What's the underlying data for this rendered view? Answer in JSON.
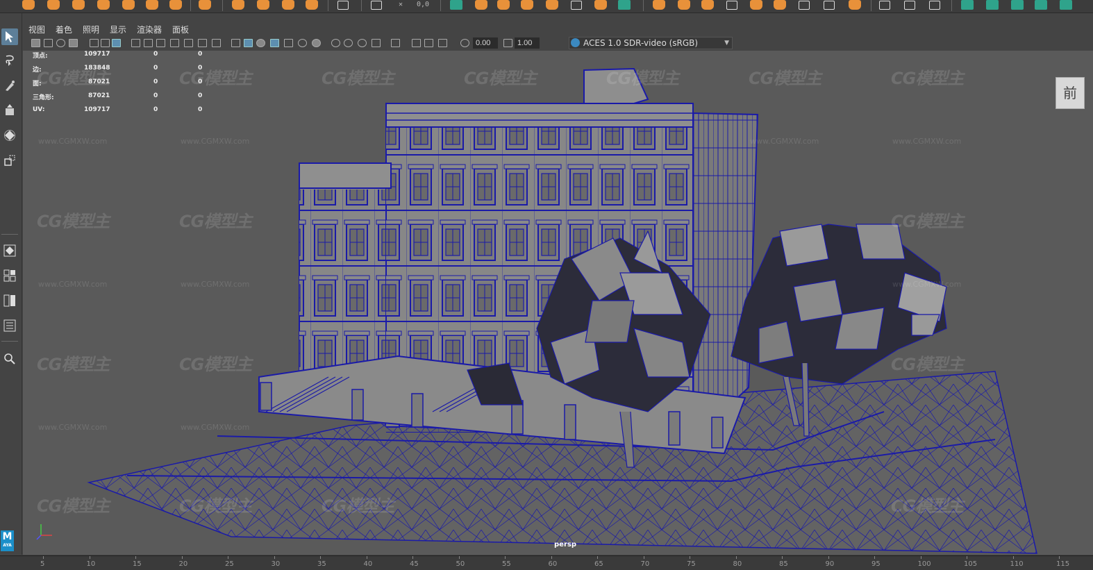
{
  "shelf": {
    "coord_readout": "0,0"
  },
  "panel_menu": {
    "items": [
      "视图",
      "着色",
      "照明",
      "显示",
      "渲染器",
      "面板"
    ]
  },
  "panel_toolbar": {
    "exposure": "0.00",
    "gamma": "1.00",
    "color_space": "ACES 1.0 SDR-video (sRGB)"
  },
  "hud": {
    "rows": [
      {
        "label": "顶点:",
        "value": "109717",
        "col2": "0",
        "col3": "0"
      },
      {
        "label": "边:",
        "value": "183848",
        "col2": "0",
        "col3": "0"
      },
      {
        "label": "面:",
        "value": "87021",
        "col2": "0",
        "col3": "0"
      },
      {
        "label": "三角形:",
        "value": "87021",
        "col2": "0",
        "col3": "0"
      },
      {
        "label": "UV:",
        "value": "109717",
        "col2": "0",
        "col3": "0"
      }
    ]
  },
  "view_cube": {
    "label": "前"
  },
  "camera_label": "persp",
  "watermark": {
    "logo_text": "CG模型主",
    "url_text": "www.CGMXW.com"
  },
  "timeline": {
    "ticks": [
      "5",
      "10",
      "15",
      "20",
      "25",
      "30",
      "35",
      "40",
      "45",
      "50",
      "55",
      "60",
      "65",
      "70",
      "75",
      "80",
      "85",
      "90",
      "95",
      "100",
      "105",
      "110",
      "115"
    ]
  },
  "maya_logo": {
    "big": "M",
    "small": "AYA"
  },
  "colors": {
    "wireframe": "#1a1aa8",
    "mesh_fill": "#8e8e8e",
    "viewport_bg": "#5a5a5a",
    "ui_bg": "#444444",
    "shelf_accent": "#e8913a",
    "shelf_accent2": "#2fa38b"
  }
}
